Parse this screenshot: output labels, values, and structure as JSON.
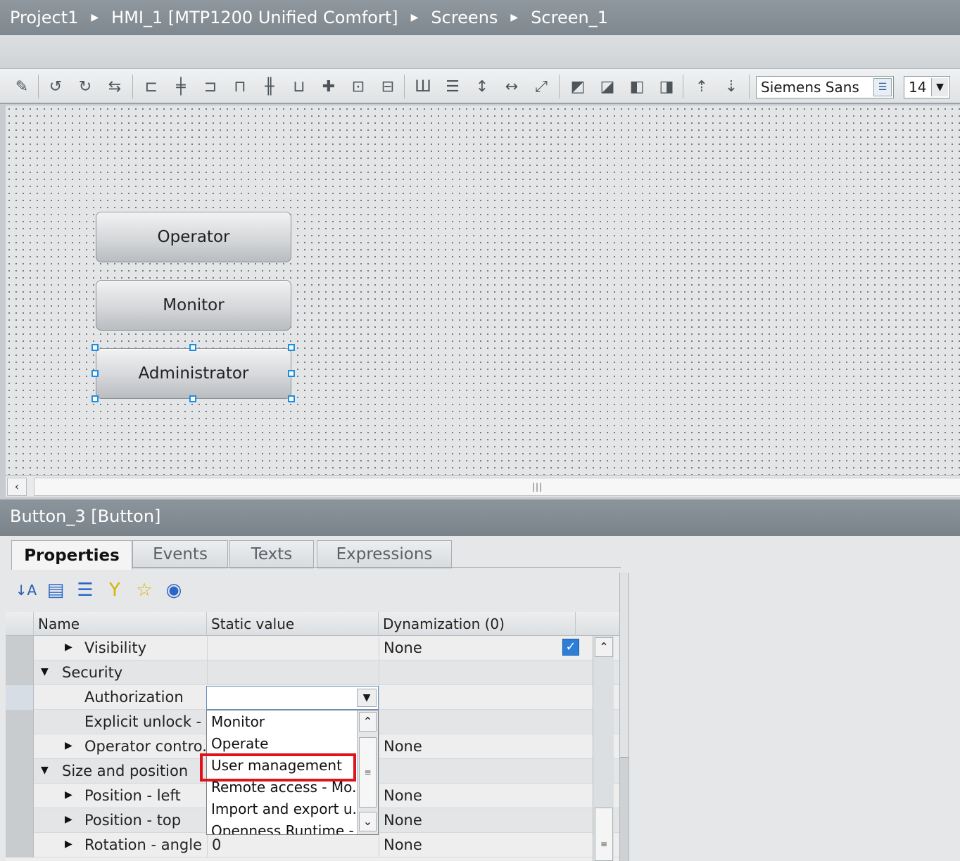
{
  "breadcrumb": [
    "Project1",
    "HMI_1 [MTP1200 Unified Comfort]",
    "Screens",
    "Screen_1"
  ],
  "toolbar": {
    "font_name": "Siemens Sans",
    "font_size": "14",
    "icons": [
      "format-painter-icon",
      "rotate-left-icon",
      "rotate-right-icon",
      "flip-icon",
      "align-left-icon",
      "align-center-icon",
      "align-right-icon",
      "align-top-icon",
      "align-middle-icon",
      "align-bottom-icon",
      "center-icon",
      "center-horizontal-icon",
      "center-vertical-icon",
      "distribute-horizontal-icon",
      "distribute-vertical-icon",
      "same-height-icon",
      "same-width-icon",
      "same-size-icon",
      "bring-to-front-icon",
      "bring-forward-icon",
      "send-backward-icon",
      "send-to-back-icon",
      "tab-order-up-icon",
      "tab-order-down-icon"
    ]
  },
  "canvas": {
    "buttons": [
      "Operator",
      "Monitor",
      "Administrator"
    ]
  },
  "properties": {
    "title": "Button_3 [Button]",
    "tabs": [
      "Properties",
      "Events",
      "Texts",
      "Expressions"
    ],
    "columns": [
      "Name",
      "Static value",
      "Dynamization (0)"
    ],
    "rows": [
      {
        "name": "Visibility",
        "static": "",
        "dyn": "None"
      },
      {
        "name": "Security",
        "static": "",
        "dyn": ""
      },
      {
        "name": "Authorization",
        "static": "",
        "dyn": ""
      },
      {
        "name": "Explicit unlock - ...",
        "static": "",
        "dyn": ""
      },
      {
        "name": "Operator contro...",
        "static": "",
        "dyn": "None"
      },
      {
        "name": "Size and position",
        "static": "",
        "dyn": ""
      },
      {
        "name": "Position - left",
        "static": "",
        "dyn": "None"
      },
      {
        "name": "Position - top",
        "static": "",
        "dyn": "None"
      },
      {
        "name": "Rotation - angle",
        "static": "0",
        "dyn": "None"
      }
    ],
    "dropdown_options": [
      "Monitor",
      "Operate",
      "User management",
      "Remote access - Mo...",
      "Import and export u...",
      "Openness Runtime -"
    ]
  },
  "colors": {
    "title_bar": "#838c93",
    "selection_handle": "#1c8fe0",
    "highlight": "#e0121c",
    "checkbox": "#2d7ed6"
  }
}
